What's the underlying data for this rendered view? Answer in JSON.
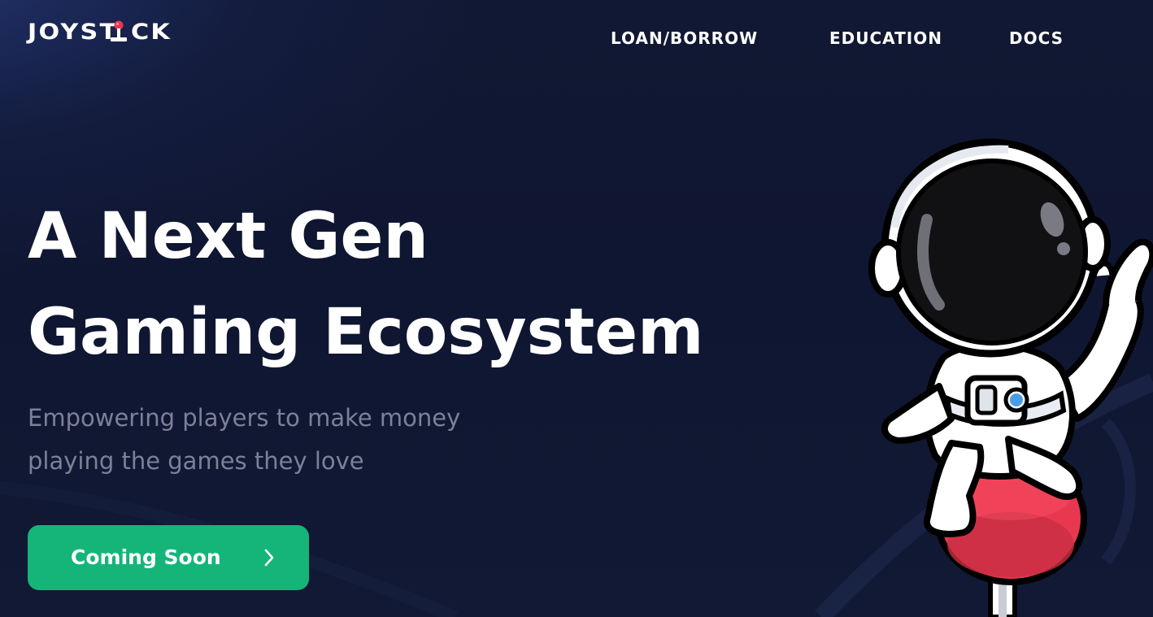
{
  "brand": {
    "logo_text_left": "JOYST",
    "logo_text_right": "CK",
    "logo_icon": "joystick-icon"
  },
  "nav": {
    "items": [
      {
        "label": "LOAN/BORROW"
      },
      {
        "label": "EDUCATION"
      },
      {
        "label": "DOCS"
      }
    ]
  },
  "hero": {
    "title_line1": "A Next Gen",
    "title_line2": "Gaming Ecosystem",
    "subtitle_line1": "Empowering players to make money",
    "subtitle_line2": "playing the games they love",
    "cta_label": "Coming Soon",
    "cta_icon": "chevron-right-icon",
    "illustration": "astronaut-on-joystick-illustration"
  },
  "colors": {
    "background": "#111833",
    "accent_green": "#15b57a",
    "subtitle_gray": "#7c8196",
    "joystick_red": "#e8384f"
  }
}
